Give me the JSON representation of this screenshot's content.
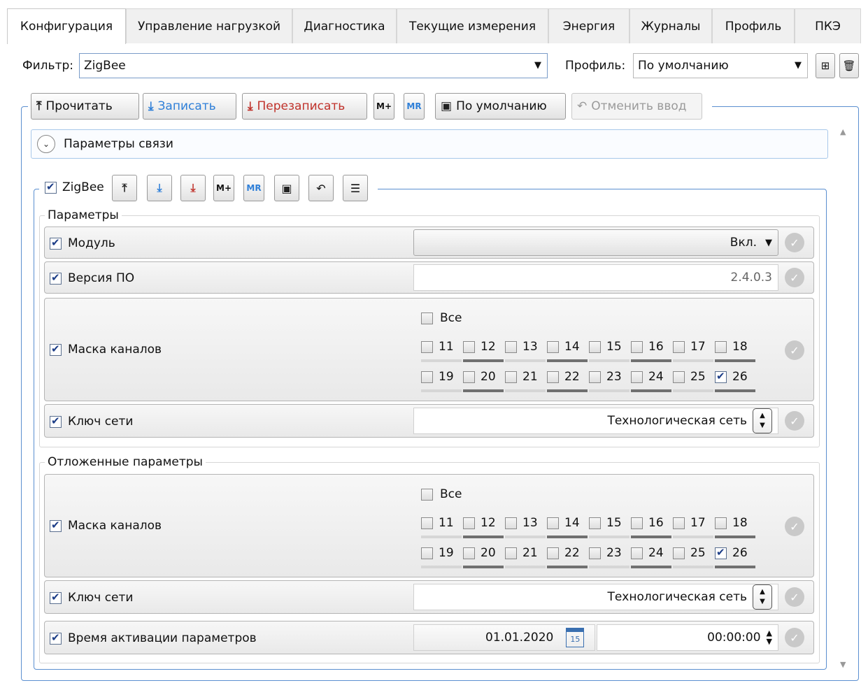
{
  "tabs": [
    {
      "label": "Конфигурация",
      "active": true
    },
    {
      "label": "Управление нагрузкой"
    },
    {
      "label": "Диагностика"
    },
    {
      "label": "Текущие измерения"
    },
    {
      "label": "Энергия"
    },
    {
      "label": "Журналы"
    },
    {
      "label": "Профиль"
    },
    {
      "label": "ПКЭ"
    }
  ],
  "filter": {
    "label": "Фильтр:",
    "value": "ZigBee"
  },
  "profile": {
    "label": "Профиль:",
    "value": "По умолчанию"
  },
  "toolbar": {
    "read": "Прочитать",
    "write": "Записать",
    "overwrite": "Перезаписать",
    "mplus": "M+",
    "mr": "MR",
    "defaults": "По умолчанию",
    "undo": "Отменить ввод"
  },
  "expander": {
    "label": "Параметры связи"
  },
  "zigbee": {
    "label": "ZigBee",
    "checked": true,
    "mplus": "M+",
    "mr": "MR"
  },
  "params": {
    "title": "Параметры",
    "module": {
      "label": "Модуль",
      "value": "Вкл."
    },
    "firmware": {
      "label": "Версия ПО",
      "value": "2.4.0.3"
    },
    "channel_mask": {
      "label": "Маска каналов",
      "all_label": "Все",
      "row1": [
        "11",
        "12",
        "13",
        "14",
        "15",
        "16",
        "17",
        "18"
      ],
      "row2": [
        "19",
        "20",
        "21",
        "22",
        "23",
        "24",
        "25",
        "26"
      ],
      "checked": [
        "26"
      ]
    },
    "network_key": {
      "label": "Ключ сети",
      "value": "Технологическая сеть"
    }
  },
  "deferred": {
    "title": "Отложенные параметры",
    "channel_mask": {
      "label": "Маска каналов",
      "all_label": "Все",
      "row1": [
        "11",
        "12",
        "13",
        "14",
        "15",
        "16",
        "17",
        "18"
      ],
      "row2": [
        "19",
        "20",
        "21",
        "22",
        "23",
        "24",
        "25",
        "26"
      ],
      "checked": [
        "26"
      ]
    },
    "network_key": {
      "label": "Ключ сети",
      "value": "Технологическая сеть"
    },
    "activation": {
      "label": "Время активации параметров",
      "date": "01.01.2020",
      "calendar_day": "15",
      "time": "00:00:00"
    }
  },
  "icons": {
    "calendar": "calendar-icon",
    "ok": "check-circle-icon",
    "spin": "up-down-spinner-icon"
  }
}
